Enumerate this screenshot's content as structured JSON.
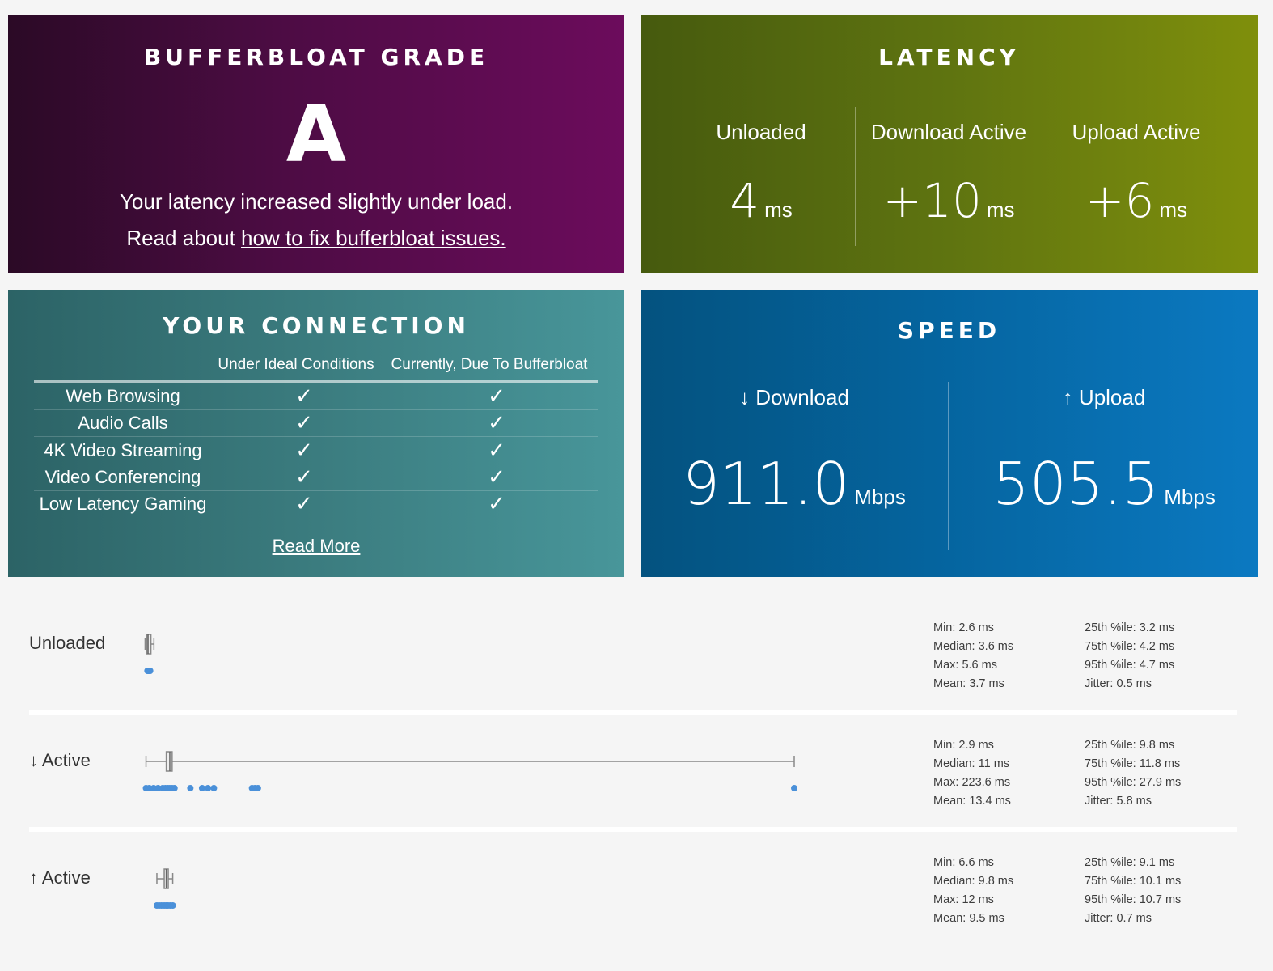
{
  "grade": {
    "title": "BUFFERBLOAT GRADE",
    "letter": "A",
    "line1": "Your latency increased slightly under load.",
    "line2_prefix": "Read about ",
    "line2_link": "how to fix bufferbloat issues."
  },
  "latency": {
    "title": "LATENCY",
    "unloaded": {
      "label": "Unloaded",
      "value": "4",
      "unit": "ms"
    },
    "download": {
      "label": "Download Active",
      "value": "+10",
      "unit": "ms"
    },
    "upload": {
      "label": "Upload Active",
      "value": "+6",
      "unit": "ms"
    }
  },
  "connection": {
    "title": "YOUR CONNECTION",
    "col_ideal": "Under Ideal Conditions",
    "col_current": "Currently, Due To Bufferbloat",
    "check_glyph": "✓",
    "rows": [
      {
        "label": "Web Browsing"
      },
      {
        "label": "Audio Calls"
      },
      {
        "label": "4K Video Streaming"
      },
      {
        "label": "Video Conferencing"
      },
      {
        "label": "Low Latency Gaming"
      }
    ],
    "read_more": "Read More"
  },
  "speed": {
    "title": "SPEED",
    "download": {
      "label": "↓ Download",
      "value": "911.0",
      "unit": "Mbps"
    },
    "upload": {
      "label": "↑ Upload",
      "value": "505.5",
      "unit": "Mbps"
    }
  },
  "details": {
    "colors": {
      "point": "#4a90d9",
      "box": "#888888"
    },
    "rows": [
      {
        "label": "Unloaded",
        "box": {
          "min": 2.6,
          "q1": 3.2,
          "median": 3.6,
          "q3": 4.2,
          "max": 5.6
        },
        "stats_left": [
          "Min: 2.6 ms",
          "Median: 3.6 ms",
          "Max: 5.6 ms",
          "Mean: 3.7 ms"
        ],
        "stats_right": [
          "25th %ile: 3.2 ms",
          "75th %ile: 4.2 ms",
          "95th %ile: 4.7 ms",
          "Jitter: 0.5 ms"
        ]
      },
      {
        "label": "↓ Active",
        "box": {
          "min": 2.9,
          "q1": 9.8,
          "median": 11,
          "q3": 11.8,
          "max": 223.6
        },
        "stats_left": [
          "Min: 2.9 ms",
          "Median: 11 ms",
          "Max: 223.6 ms",
          "Mean: 13.4 ms"
        ],
        "stats_right": [
          "25th %ile: 9.8 ms",
          "75th %ile: 11.8 ms",
          "95th %ile: 27.9 ms",
          "Jitter: 5.8 ms"
        ]
      },
      {
        "label": "↑ Active",
        "box": {
          "min": 6.6,
          "q1": 9.1,
          "median": 9.8,
          "q3": 10.1,
          "max": 12
        },
        "stats_left": [
          "Min: 6.6 ms",
          "Median: 9.8 ms",
          "Max: 12 ms",
          "Mean: 9.5 ms"
        ],
        "stats_right": [
          "25th %ile: 9.1 ms",
          "75th %ile: 10.1 ms",
          "95th %ile: 10.7 ms",
          "Jitter: 0.7 ms"
        ]
      }
    ]
  }
}
